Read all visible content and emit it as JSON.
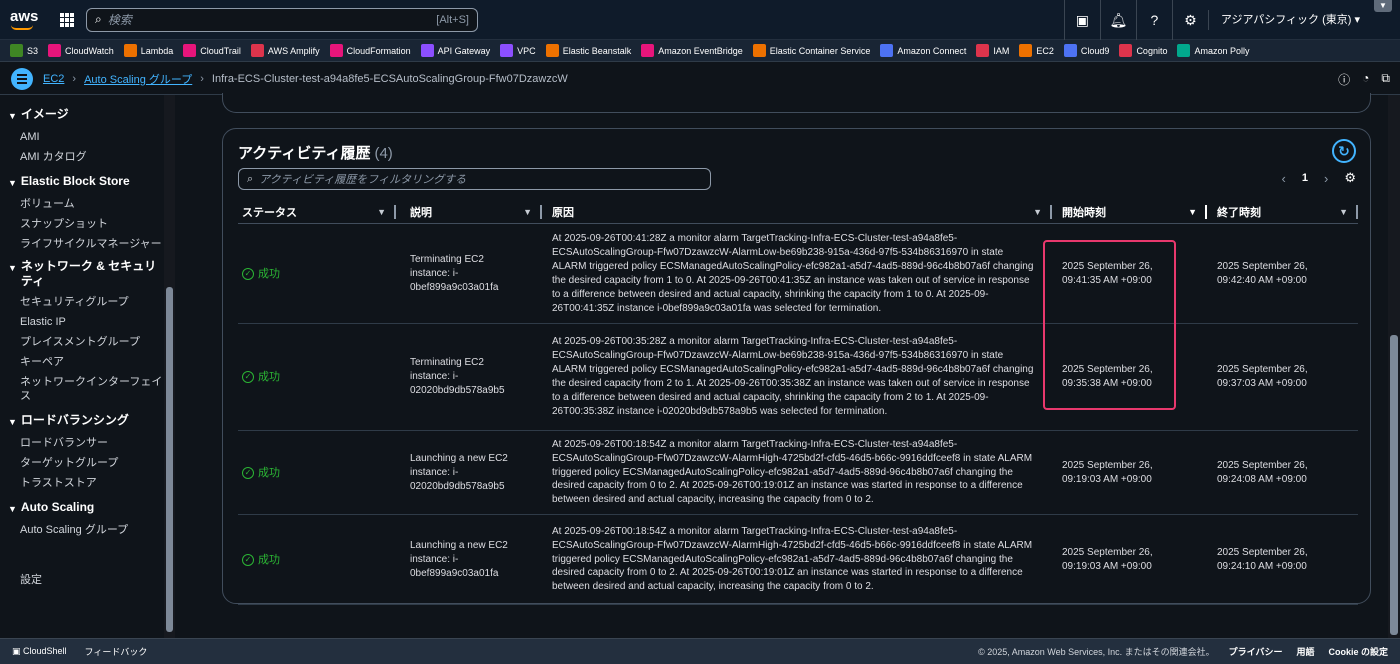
{
  "topbar": {
    "logo": "aws",
    "search_placeholder": "検索",
    "search_shortcut": "[Alt+S]",
    "region": "アジアパシフィック (東京)"
  },
  "favorites": [
    {
      "label": "S3",
      "color": "#3f8624"
    },
    {
      "label": "CloudWatch",
      "color": "#e7157b"
    },
    {
      "label": "Lambda",
      "color": "#ed7100"
    },
    {
      "label": "CloudTrail",
      "color": "#e7157b"
    },
    {
      "label": "AWS Amplify",
      "color": "#dd344c"
    },
    {
      "label": "CloudFormation",
      "color": "#e7157b"
    },
    {
      "label": "API Gateway",
      "color": "#8c4fff"
    },
    {
      "label": "VPC",
      "color": "#8c4fff"
    },
    {
      "label": "Elastic Beanstalk",
      "color": "#ed7100"
    },
    {
      "label": "Amazon EventBridge",
      "color": "#e7157b"
    },
    {
      "label": "Elastic Container Service",
      "color": "#ed7100"
    },
    {
      "label": "Amazon Connect",
      "color": "#4d72f3"
    },
    {
      "label": "IAM",
      "color": "#dd344c"
    },
    {
      "label": "EC2",
      "color": "#ed7100"
    },
    {
      "label": "Cloud9",
      "color": "#4d72f3"
    },
    {
      "label": "Cognito",
      "color": "#dd344c"
    },
    {
      "label": "Amazon Polly",
      "color": "#01a88d"
    }
  ],
  "breadcrumb": {
    "ec2": "EC2",
    "asg": "Auto Scaling グループ",
    "current": "Infra-ECS-Cluster-test-a94a8fe5-ECSAutoScalingGroup-Ffw07DzawzcW"
  },
  "sidebar": [
    {
      "type": "sec",
      "label": "イメージ"
    },
    {
      "type": "item",
      "label": "AMI"
    },
    {
      "type": "item",
      "label": "AMI カタログ"
    },
    {
      "type": "sec",
      "label": "Elastic Block Store"
    },
    {
      "type": "item",
      "label": "ボリューム"
    },
    {
      "type": "item",
      "label": "スナップショット"
    },
    {
      "type": "item",
      "label": "ライフサイクルマネージャー"
    },
    {
      "type": "sec",
      "label": "ネットワーク & セキュリティ"
    },
    {
      "type": "item",
      "label": "セキュリティグループ"
    },
    {
      "type": "item",
      "label": "Elastic IP"
    },
    {
      "type": "item",
      "label": "プレイスメントグループ"
    },
    {
      "type": "item",
      "label": "キーペア"
    },
    {
      "type": "item",
      "label": "ネットワークインターフェイス"
    },
    {
      "type": "sec",
      "label": "ロードバランシング"
    },
    {
      "type": "item",
      "label": "ロードバランサー"
    },
    {
      "type": "item",
      "label": "ターゲットグループ"
    },
    {
      "type": "item",
      "label": "トラストストア"
    },
    {
      "type": "sec",
      "label": "Auto Scaling"
    },
    {
      "type": "item",
      "label": "Auto Scaling グループ"
    },
    {
      "type": "item",
      "label": "設定"
    }
  ],
  "activity": {
    "title": "アクティビティ履歴",
    "count": "(4)",
    "filter_placeholder": "アクティビティ履歴をフィルタリングする",
    "page": "1",
    "columns": [
      "ステータス",
      "説明",
      "原因",
      "開始時刻",
      "終了時刻"
    ],
    "rows": [
      {
        "status": "成功",
        "description": "Terminating EC2 instance: i-0bef899a9c03a01fa",
        "cause": "At 2025-09-26T00:41:28Z a monitor alarm TargetTracking-Infra-ECS-Cluster-test-a94a8fe5-ECSAutoScalingGroup-Ffw07DzawzcW-AlarmLow-be69b238-915a-436d-97f5-534b86316970 in state ALARM triggered policy ECSManagedAutoScalingPolicy-efc982a1-a5d7-4ad5-889d-96c4b8b07a6f changing the desired capacity from 1 to 0. At 2025-09-26T00:41:35Z an instance was taken out of service in response to a difference between desired and actual capacity, shrinking the capacity from 1 to 0. At 2025-09-26T00:41:35Z instance i-0bef899a9c03a01fa was selected for termination.",
        "start": "2025 September 26, 09:41:35 AM +09:00",
        "end": "2025 September 26, 09:42:40 AM +09:00"
      },
      {
        "status": "成功",
        "description": "Terminating EC2 instance: i-02020bd9db578a9b5",
        "cause": "At 2025-09-26T00:35:28Z a monitor alarm TargetTracking-Infra-ECS-Cluster-test-a94a8fe5-ECSAutoScalingGroup-Ffw07DzawzcW-AlarmLow-be69b238-915a-436d-97f5-534b86316970 in state ALARM triggered policy ECSManagedAutoScalingPolicy-efc982a1-a5d7-4ad5-889d-96c4b8b07a6f changing the desired capacity from 2 to 1. At 2025-09-26T00:35:38Z an instance was taken out of service in response to a difference between desired and actual capacity, shrinking the capacity from 2 to 1. At 2025-09-26T00:35:38Z instance i-02020bd9db578a9b5 was selected for termination.",
        "start": "2025 September 26, 09:35:38 AM +09:00",
        "end": "2025 September 26, 09:37:03 AM +09:00"
      },
      {
        "status": "成功",
        "description": "Launching a new EC2 instance: i-02020bd9db578a9b5",
        "cause": "At 2025-09-26T00:18:54Z a monitor alarm TargetTracking-Infra-ECS-Cluster-test-a94a8fe5-ECSAutoScalingGroup-Ffw07DzawzcW-AlarmHigh-4725bd2f-cfd5-46d5-b66c-9916ddfceef8 in state ALARM triggered policy ECSManagedAutoScalingPolicy-efc982a1-a5d7-4ad5-889d-96c4b8b07a6f changing the desired capacity from 0 to 2. At 2025-09-26T00:19:01Z an instance was started in response to a difference between desired and actual capacity, increasing the capacity from 0 to 2.",
        "start": "2025 September 26, 09:19:03 AM +09:00",
        "end": "2025 September 26, 09:24:08 AM +09:00"
      },
      {
        "status": "成功",
        "description": "Launching a new EC2 instance: i-0bef899a9c03a01fa",
        "cause": "At 2025-09-26T00:18:54Z a monitor alarm TargetTracking-Infra-ECS-Cluster-test-a94a8fe5-ECSAutoScalingGroup-Ffw07DzawzcW-AlarmHigh-4725bd2f-cfd5-46d5-b66c-9916ddfceef8 in state ALARM triggered policy ECSManagedAutoScalingPolicy-efc982a1-a5d7-4ad5-889d-96c4b8b07a6f changing the desired capacity from 0 to 2. At 2025-09-26T00:19:01Z an instance was started in response to a difference between desired and actual capacity, increasing the capacity from 0 to 2.",
        "start": "2025 September 26, 09:19:03 AM +09:00",
        "end": "2025 September 26, 09:24:10 AM +09:00"
      }
    ]
  },
  "footer": {
    "cloudshell": "CloudShell",
    "feedback": "フィードバック",
    "copyright": "© 2025, Amazon Web Services, Inc. またはその関連会社。",
    "privacy": "プライバシー",
    "terms": "用語",
    "cookie": "Cookie の設定"
  }
}
